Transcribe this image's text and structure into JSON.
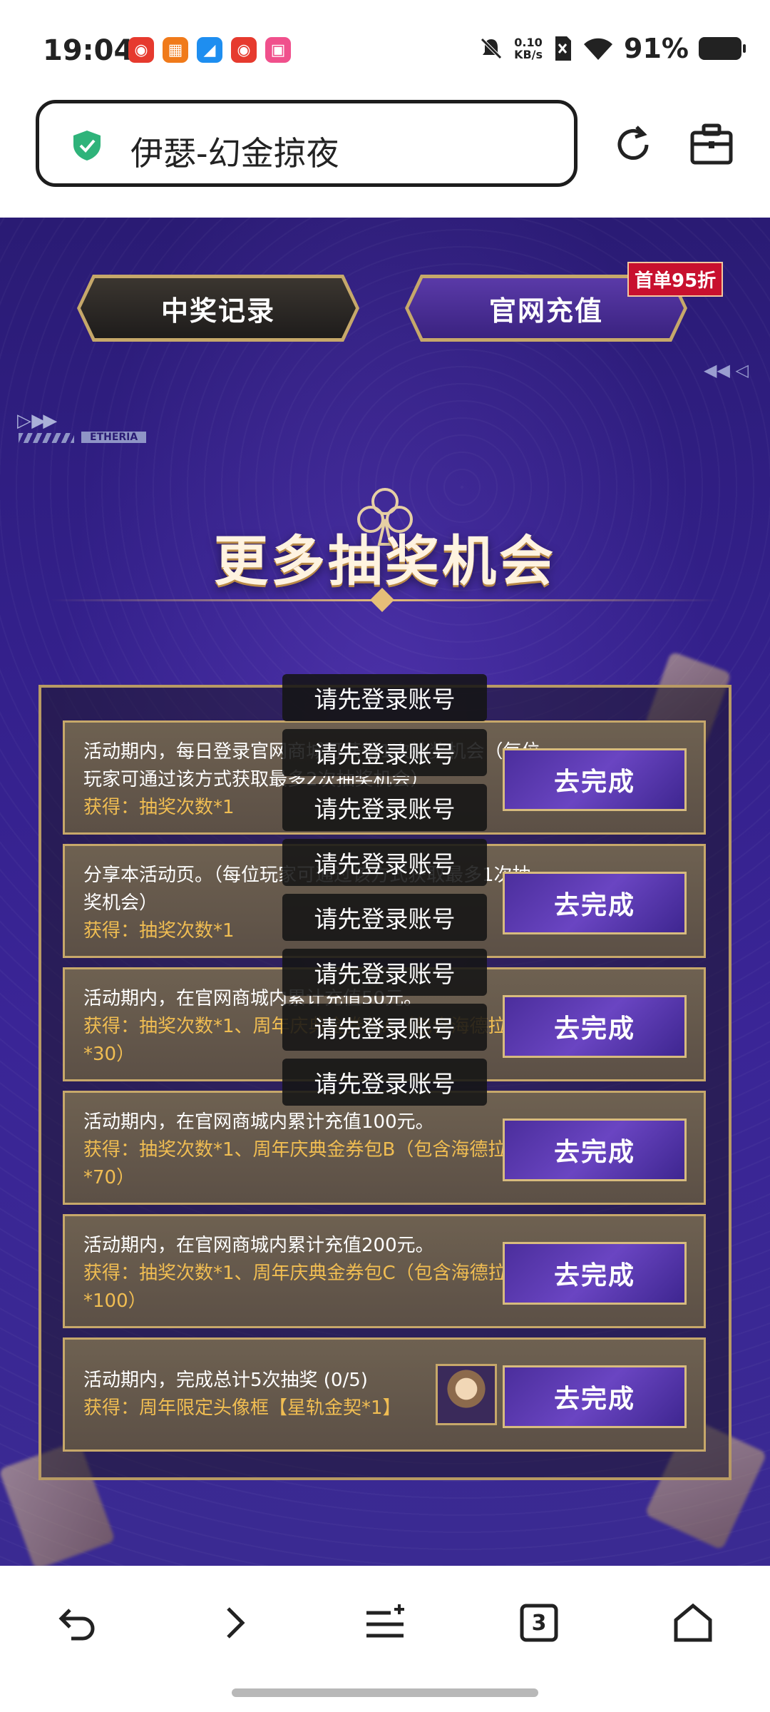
{
  "status_bar": {
    "time": "19:04",
    "net_speed_value": "0.10",
    "net_speed_unit": "KB/s",
    "battery": "91%",
    "icons": [
      "notification-app-icon",
      "grid-app-icon",
      "blue-app-icon",
      "red-app-icon",
      "pink-app-icon",
      "mute-icon",
      "sim-off-icon",
      "wifi-icon",
      "battery-icon"
    ]
  },
  "browser": {
    "page_title": "伊瑟-幻金掠夜",
    "icons": [
      "shield-check-icon",
      "reload-icon",
      "toolbox-icon"
    ]
  },
  "page": {
    "top_buttons": {
      "records": "中奖记录",
      "recharge": "官网充值",
      "badge": "首单95折"
    },
    "deco_tag": "ETHERIA",
    "section_title": "更多抽奖机会",
    "tasks": [
      {
        "desc": "活动期内，每日登录官网商城可获得1次抽奖机会（每位玩家可通过该方式获取最多2次抽奖机会）",
        "reward": "获得：抽奖次数*1",
        "button": "去完成"
      },
      {
        "desc": "分享本活动页。（每位玩家可通过该方式获取最多1次抽奖机会）",
        "reward": "获得：抽奖次数*1",
        "button": "去完成"
      },
      {
        "desc": "活动期内，在官网商城内累计充值50元。",
        "reward": "获得：抽奖次数*1、周年庆典金券包A（包含海德拉金券*30）",
        "button": "去完成"
      },
      {
        "desc": "活动期内，在官网商城内累计充值100元。",
        "reward": "获得：抽奖次数*1、周年庆典金券包B（包含海德拉金券*70）",
        "button": "去完成"
      },
      {
        "desc": "活动期内，在官网商城内累计充值200元。",
        "reward": "获得：抽奖次数*1、周年庆典金券包C（包含海德拉金券*100）",
        "button": "去完成"
      },
      {
        "desc": "活动期内，完成总计5次抽奖 (0/5)",
        "reward": "获得：周年限定头像框【星轨金契*1】",
        "button": "去完成"
      }
    ],
    "toasts": [
      "请先登录账号",
      "请先登录账号",
      "请先登录账号",
      "请先登录账号",
      "请先登录账号",
      "请先登录账号",
      "请先登录账号",
      "请先登录账号"
    ]
  },
  "bottom_nav": {
    "tab_count": "3",
    "icons": [
      "back-icon",
      "forward-icon",
      "menu-icon",
      "tabs-icon",
      "home-icon"
    ]
  },
  "colors": {
    "bg_purple": "#33208a",
    "gold": "#c7a86a",
    "reward_text": "#f0bd52",
    "badge_red": "#c8102e"
  }
}
